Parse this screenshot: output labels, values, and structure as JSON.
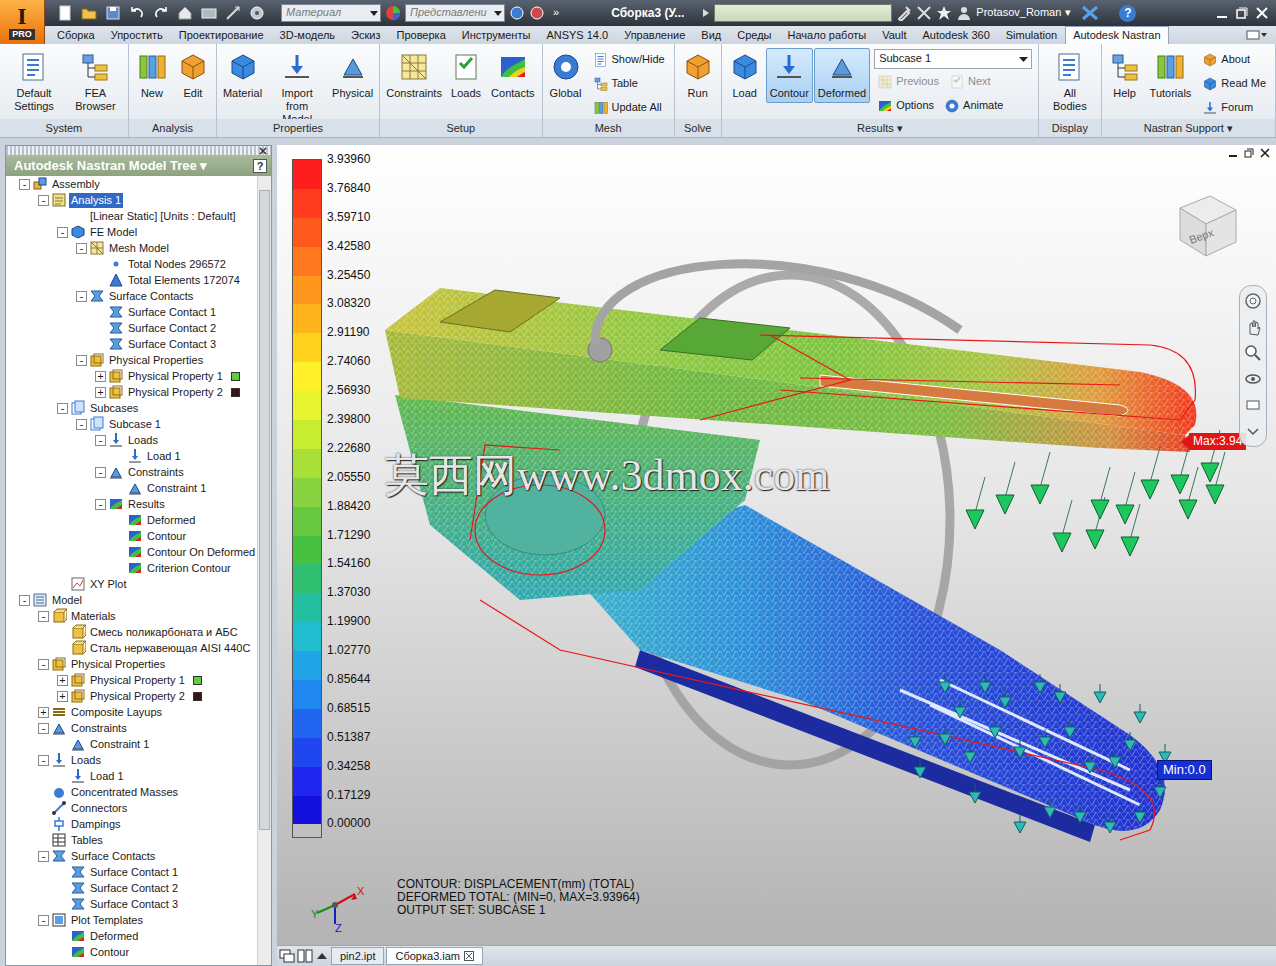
{
  "title_bar": {
    "app_letter": "I",
    "edition": "PRO",
    "material": "Материал",
    "appearance": "Представлени",
    "more": "»",
    "title": "Сборка3 (У...",
    "user": "Protasov_Roman",
    "user_arrow": "▾",
    "help": "?"
  },
  "tabs": [
    {
      "label": "Сборка",
      "selected": false
    },
    {
      "label": "Упростить",
      "selected": false
    },
    {
      "label": "Проектирование",
      "selected": false
    },
    {
      "label": "3D-модель",
      "selected": false
    },
    {
      "label": "Эскиз",
      "selected": false
    },
    {
      "label": "Проверка",
      "selected": false
    },
    {
      "label": "Инструменты",
      "selected": false
    },
    {
      "label": "ANSYS 14.0",
      "selected": false
    },
    {
      "label": "Управление",
      "selected": false
    },
    {
      "label": "Вид",
      "selected": false
    },
    {
      "label": "Среды",
      "selected": false
    },
    {
      "label": "Начало работы",
      "selected": false
    },
    {
      "label": "Vault",
      "selected": false
    },
    {
      "label": "Autodesk 360",
      "selected": false
    },
    {
      "label": "Simulation",
      "selected": false
    },
    {
      "label": "Autodesk Nastran",
      "selected": true
    }
  ],
  "ribbon": {
    "groups": [
      {
        "label": "System",
        "items": [
          {
            "kind": "large",
            "label": "Default Settings",
            "selected": false,
            "disabled": false
          },
          {
            "kind": "large",
            "label": "FEA Browser",
            "selected": false,
            "disabled": false
          }
        ]
      },
      {
        "label": "Analysis",
        "items": [
          {
            "kind": "large",
            "label": "New",
            "selected": false,
            "disabled": false
          },
          {
            "kind": "large",
            "label": "Edit",
            "selected": false,
            "disabled": false
          }
        ]
      },
      {
        "label": "Properties",
        "items": [
          {
            "kind": "large",
            "label": "Material",
            "selected": false,
            "disabled": false
          },
          {
            "kind": "large",
            "label": "Import from Model",
            "selected": false,
            "disabled": false
          },
          {
            "kind": "large",
            "label": "Physical",
            "selected": false,
            "disabled": false
          }
        ]
      },
      {
        "label": "Setup",
        "items": [
          {
            "kind": "large",
            "label": "Constraints",
            "selected": false,
            "disabled": false
          },
          {
            "kind": "large",
            "label": "Loads",
            "selected": false,
            "disabled": false
          },
          {
            "kind": "large",
            "label": "Contacts",
            "selected": false,
            "disabled": false
          }
        ]
      },
      {
        "label": "Mesh",
        "items": [
          {
            "kind": "large",
            "label": "Global",
            "selected": false,
            "disabled": false
          },
          {
            "kind": "stack",
            "rows": [
              [
                {
                  "kind": "small",
                  "label": "Show/Hide",
                  "selected": false,
                  "disabled": false
                }
              ],
              [
                {
                  "kind": "small",
                  "label": "Table",
                  "selected": false,
                  "disabled": false
                }
              ],
              [
                {
                  "kind": "small",
                  "label": "Update All",
                  "selected": false,
                  "disabled": false
                }
              ]
            ]
          }
        ]
      },
      {
        "label": "Solve",
        "items": [
          {
            "kind": "large",
            "label": "Run",
            "selected": false,
            "disabled": false
          }
        ]
      },
      {
        "label": "Results ▾",
        "items": [
          {
            "kind": "large",
            "label": "Load",
            "selected": false,
            "disabled": false
          },
          {
            "kind": "large",
            "label": "Contour",
            "selected": true,
            "disabled": false
          },
          {
            "kind": "large",
            "label": "Deformed",
            "selected": true,
            "disabled": false
          },
          {
            "kind": "stack",
            "rows": [
              [
                {
                  "kind": "dropdown",
                  "label": "Subcase 1",
                  "selected": false,
                  "disabled": false
                }
              ],
              [
                {
                  "kind": "small",
                  "label": "Previous",
                  "selected": false,
                  "disabled": true
                },
                {
                  "kind": "small",
                  "label": "Next",
                  "selected": false,
                  "disabled": true
                }
              ],
              [
                {
                  "kind": "small",
                  "label": "Options",
                  "selected": false,
                  "disabled": false
                },
                {
                  "kind": "small",
                  "label": "Animate",
                  "selected": false,
                  "disabled": false
                }
              ]
            ]
          }
        ]
      },
      {
        "label": "Display",
        "items": [
          {
            "kind": "large",
            "label": "All Bodies",
            "selected": false,
            "disabled": false
          }
        ]
      },
      {
        "label": "Nastran Support ▾",
        "items": [
          {
            "kind": "large",
            "label": "Help",
            "selected": false,
            "disabled": false
          },
          {
            "kind": "large",
            "label": "Tutorials",
            "selected": false,
            "disabled": false
          },
          {
            "kind": "stack",
            "rows": [
              [
                {
                  "kind": "small",
                  "label": "About",
                  "selected": false,
                  "disabled": false
                }
              ],
              [
                {
                  "kind": "small",
                  "label": "Read Me",
                  "selected": false,
                  "disabled": false
                }
              ],
              [
                {
                  "kind": "small",
                  "label": "Forum",
                  "selected": false,
                  "disabled": false
                }
              ]
            ]
          }
        ]
      }
    ]
  },
  "model_tree": {
    "title": "Autodesk Nastran Model Tree ▾",
    "help": "?",
    "items": [
      {
        "label": "Assembly",
        "kind": "assembly",
        "toggle": "-",
        "selected": false,
        "children": [
          {
            "label": "Analysis 1",
            "kind": "analysis",
            "toggle": "-",
            "selected": true,
            "children": [
              {
                "label": "[Linear Static] [Units : Default]",
                "kind": "text",
                "selected": false
              },
              {
                "label": "FE Model",
                "kind": "fe",
                "toggle": "-",
                "selected": false,
                "children": [
                  {
                    "label": "Mesh Model",
                    "kind": "mesh",
                    "toggle": "-",
                    "selected": false,
                    "children": [
                      {
                        "label": "Total Nodes 296572",
                        "kind": "node",
                        "selected": false
                      },
                      {
                        "label": "Total Elements 172074",
                        "kind": "element",
                        "selected": false
                      }
                    ]
                  },
                  {
                    "label": "Surface Contacts",
                    "kind": "contact",
                    "toggle": "-",
                    "selected": false,
                    "children": [
                      {
                        "label": "Surface Contact 1",
                        "kind": "contact",
                        "selected": false
                      },
                      {
                        "label": "Surface Contact 2",
                        "kind": "contact",
                        "selected": false
                      },
                      {
                        "label": "Surface Contact 3",
                        "kind": "contact",
                        "selected": false
                      }
                    ]
                  },
                  {
                    "label": "Physical Properties",
                    "kind": "property",
                    "toggle": "-",
                    "selected": false,
                    "children": [
                      {
                        "label": "Physical Property 1",
                        "kind": "property",
                        "toggle": "+",
                        "selected": false,
                        "color": "#5ecf3a"
                      },
                      {
                        "label": "Physical Property 2",
                        "kind": "property",
                        "toggle": "+",
                        "selected": false,
                        "color": "#3a1414"
                      }
                    ]
                  }
                ]
              },
              {
                "label": "Subcases",
                "kind": "subcase",
                "toggle": "-",
                "selected": false,
                "children": [
                  {
                    "label": "Subcase 1",
                    "kind": "subcase",
                    "toggle": "-",
                    "selected": false,
                    "children": [
                      {
                        "label": "Loads",
                        "kind": "load",
                        "toggle": "-",
                        "selected": false,
                        "children": [
                          {
                            "label": "Load 1",
                            "kind": "load",
                            "selected": false
                          }
                        ]
                      },
                      {
                        "label": "Constraints",
                        "kind": "constraint",
                        "toggle": "-",
                        "selected": false,
                        "children": [
                          {
                            "label": "Constraint 1",
                            "kind": "constraint",
                            "selected": false
                          }
                        ]
                      },
                      {
                        "label": "Results",
                        "kind": "result",
                        "toggle": "-",
                        "selected": false,
                        "children": [
                          {
                            "label": "Deformed",
                            "kind": "result",
                            "selected": false
                          },
                          {
                            "label": "Contour",
                            "kind": "result",
                            "selected": false
                          },
                          {
                            "label": "Contour On Deformed",
                            "kind": "result",
                            "selected": false
                          },
                          {
                            "label": "Criterion Contour",
                            "kind": "result",
                            "selected": false
                          }
                        ]
                      }
                    ]
                  }
                ]
              },
              {
                "label": "XY Plot",
                "kind": "plot",
                "selected": false
              }
            ]
          }
        ]
      },
      {
        "label": "Model",
        "kind": "model",
        "toggle": "-",
        "selected": false,
        "children": [
          {
            "label": "Materials",
            "kind": "material",
            "toggle": "-",
            "selected": false,
            "children": [
              {
                "label": "Смесь поликарбоната и АБС",
                "kind": "material",
                "selected": false
              },
              {
                "label": "Сталь нержавеющая AISI 440C",
                "kind": "material",
                "selected": false
              }
            ]
          },
          {
            "label": "Physical Properties",
            "kind": "property",
            "toggle": "-",
            "selected": false,
            "children": [
              {
                "label": "Physical Property 1",
                "kind": "property",
                "toggle": "+",
                "selected": false,
                "color": "#5ecf3a"
              },
              {
                "label": "Physical Property 2",
                "kind": "property",
                "toggle": "+",
                "selected": false,
                "color": "#3a1414"
              }
            ]
          },
          {
            "label": "Composite Layups",
            "kind": "layup",
            "toggle": "+",
            "selected": false
          },
          {
            "label": "Constraints",
            "kind": "constraint",
            "toggle": "-",
            "selected": false,
            "children": [
              {
                "label": "Constraint 1",
                "kind": "constraint",
                "selected": false
              }
            ]
          },
          {
            "label": "Loads",
            "kind": "load",
            "toggle": "-",
            "selected": false,
            "children": [
              {
                "label": "Load 1",
                "kind": "load",
                "selected": false
              }
            ]
          },
          {
            "label": "Concentrated Masses",
            "kind": "mass",
            "selected": false
          },
          {
            "label": "Connectors",
            "kind": "connector",
            "selected": false
          },
          {
            "label": "Dampings",
            "kind": "damping",
            "selected": false
          },
          {
            "label": "Tables",
            "kind": "table",
            "selected": false
          },
          {
            "label": "Surface Contacts",
            "kind": "contact",
            "toggle": "-",
            "selected": false,
            "children": [
              {
                "label": "Surface Contact 1",
                "kind": "contact",
                "selected": false
              },
              {
                "label": "Surface Contact 2",
                "kind": "contact",
                "selected": false
              },
              {
                "label": "Surface Contact 3",
                "kind": "contact",
                "selected": false
              }
            ]
          },
          {
            "label": "Plot Templates",
            "kind": "template",
            "toggle": "-",
            "selected": false,
            "children": [
              {
                "label": "Deformed",
                "kind": "result",
                "selected": false
              },
              {
                "label": "Contour",
                "kind": "result",
                "selected": false
              }
            ]
          }
        ]
      }
    ]
  },
  "viewport": {
    "legend": {
      "values": [
        "3.93960",
        "3.76840",
        "3.59710",
        "3.42580",
        "3.25450",
        "3.08320",
        "2.91190",
        "2.74060",
        "2.56930",
        "2.39800",
        "2.22680",
        "2.05550",
        "1.88420",
        "1.71290",
        "1.54160",
        "1.37030",
        "1.19900",
        "1.02770",
        "0.85644",
        "0.68515",
        "0.51387",
        "0.34258",
        "0.17129",
        "0.00000"
      ],
      "colors": [
        "#ff1e1e",
        "#ff3c1e",
        "#ff5a1e",
        "#ff781e",
        "#ff961e",
        "#ffb41e",
        "#ffd21e",
        "#fff02a",
        "#e6f530",
        "#c8ec30",
        "#a8e038",
        "#88d440",
        "#68c840",
        "#48c040",
        "#30bf70",
        "#22c0a0",
        "#20bcd0",
        "#20a4e6",
        "#2086f0",
        "#2066f0",
        "#2046f0",
        "#2026ee",
        "#1410dc"
      ]
    },
    "watermark": "莫西网www.3dmox.com",
    "max_label": "Max:3.94",
    "min_label": "Min:0.0",
    "info_lines": [
      "CONTOUR: DISPLACEMENT(mm) (TOTAL)",
      "DEFORMED TOTAL: (MIN=0, MAX=3.93964)",
      "OUTPUT SET: SUBCASE 1"
    ],
    "viewcube": "Верх",
    "axes": [
      "X",
      "Y",
      "Z"
    ]
  },
  "document_tabs": [
    {
      "label": "pin2.ipt",
      "selected": false
    },
    {
      "label": "Сборка3.iam",
      "selected": true
    }
  ]
}
